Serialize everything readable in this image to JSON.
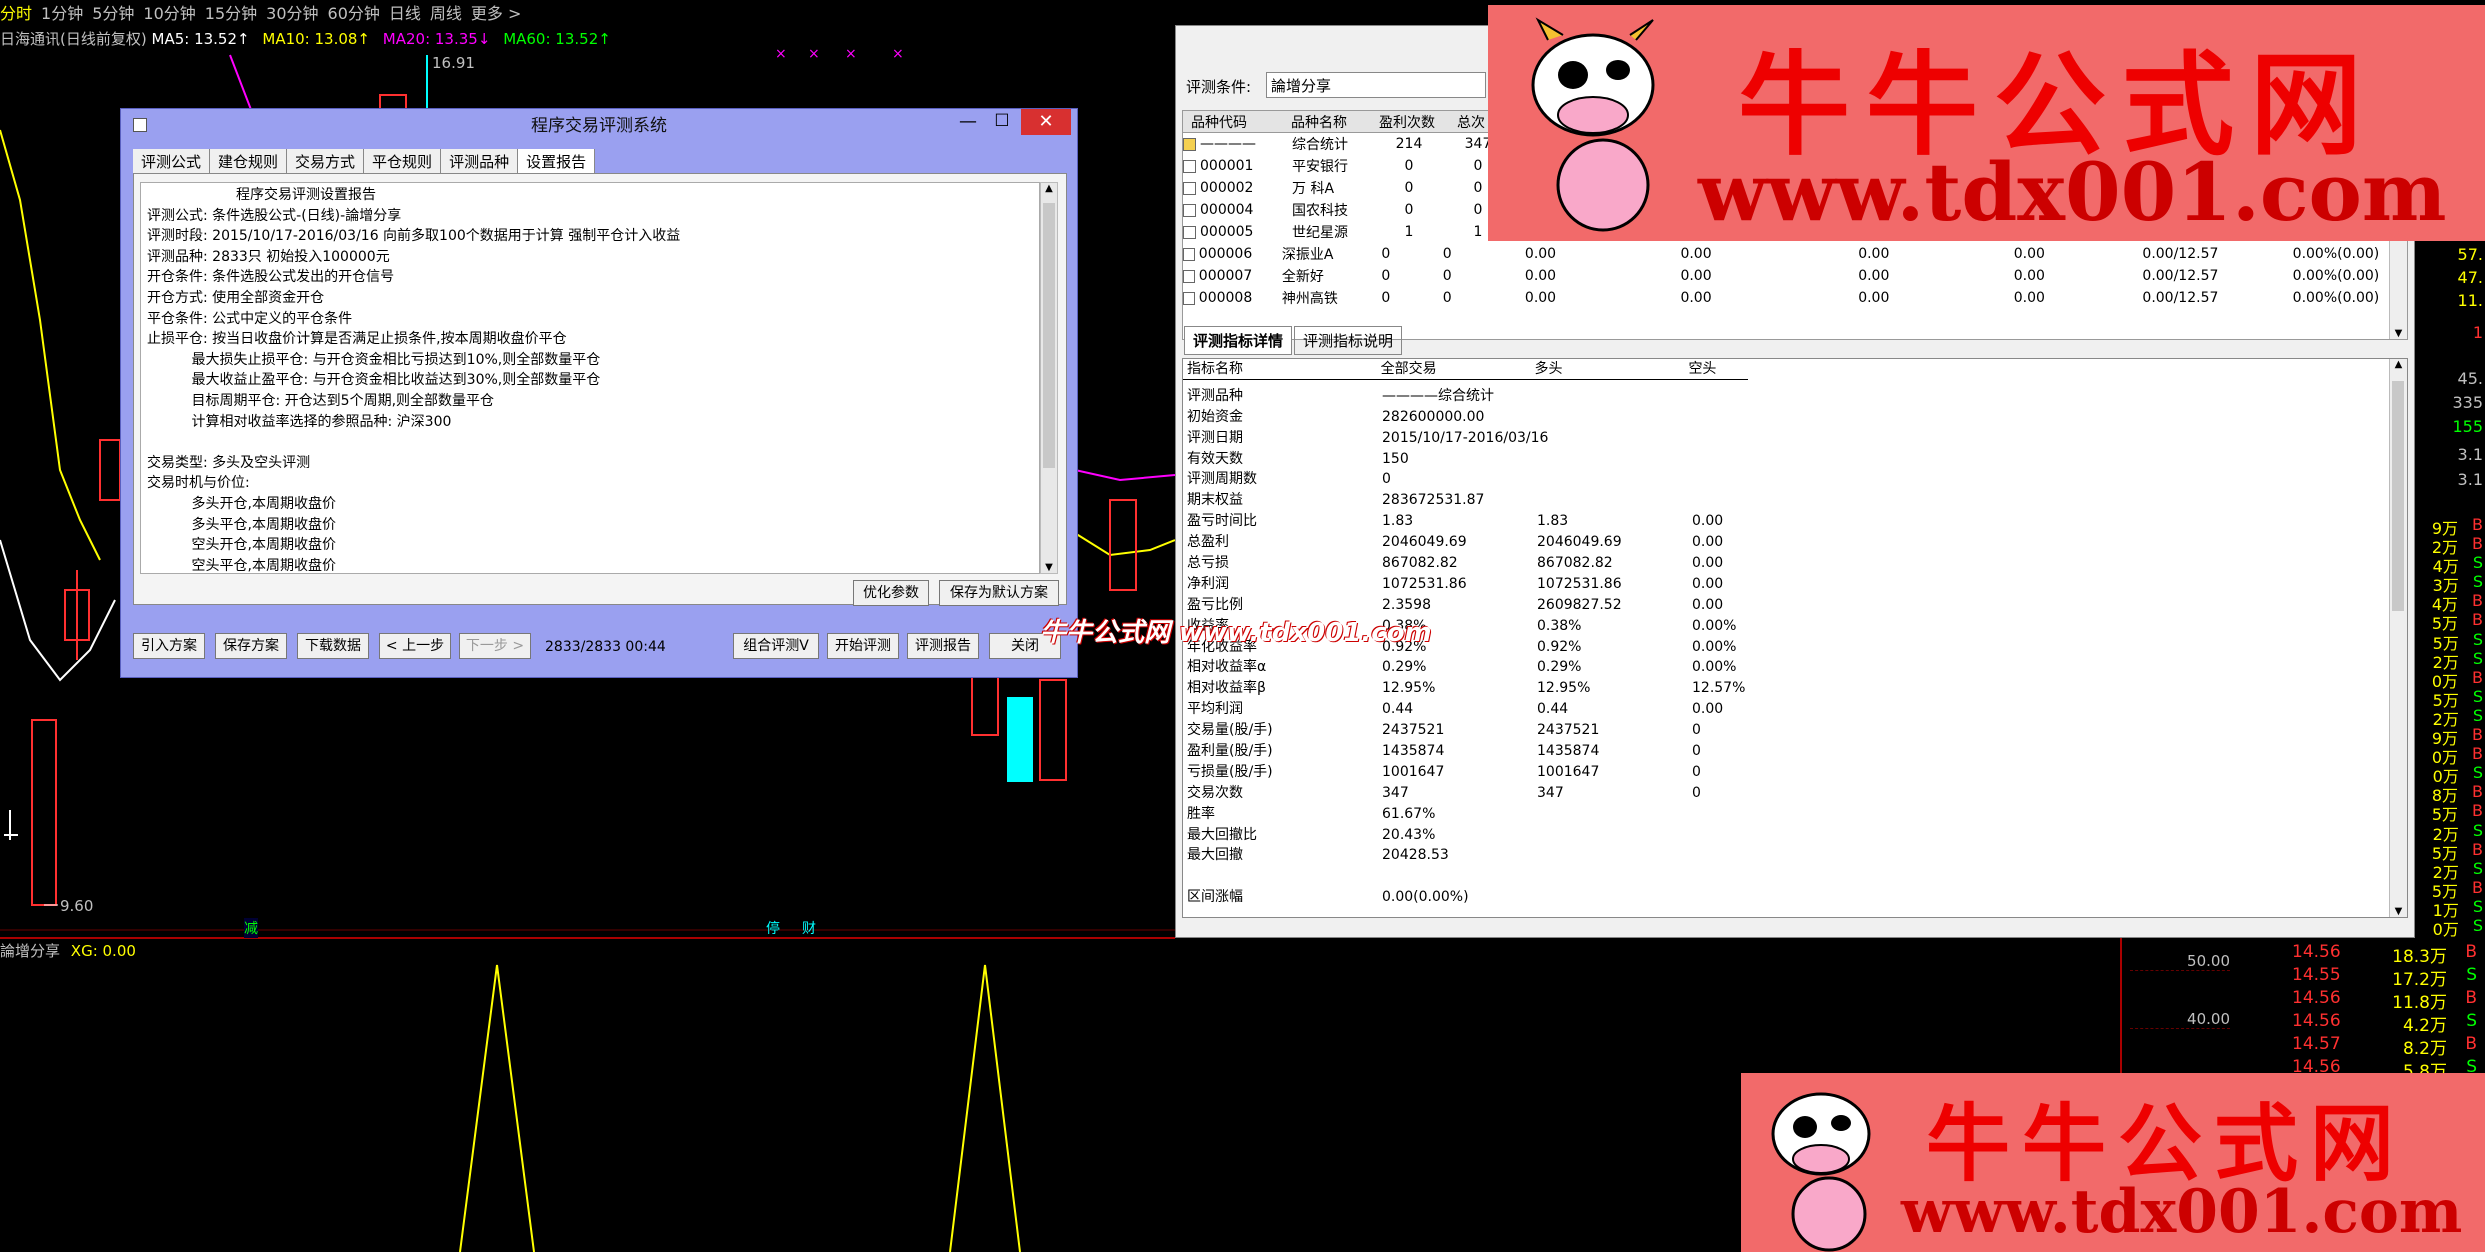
{
  "topbar": {
    "items": [
      "分时",
      "1分钟",
      "5分钟",
      "10分钟",
      "15分钟",
      "30分钟",
      "60分钟",
      "日线",
      "周线",
      "更多 >"
    ]
  },
  "chart": {
    "title": "日海通讯(日线前复权)",
    "ma5": "MA5: 13.52↑",
    "ma10": "MA10: 13.08↑",
    "ma20": "MA20: 13.35↓",
    "ma60": "MA60: 13.52↑",
    "high_label": "16.91",
    "low_label": "9.60",
    "marker_jian": "减",
    "marker_ting": "停",
    "marker_cai": "财",
    "sub_title": "論增分享",
    "sub_xg": "XG: 0.00",
    "sub_axis": [
      "50.00",
      "40.00"
    ],
    "colors": {
      "ma5": "#ffffff",
      "ma10": "#ffff00",
      "ma20": "#ff00ff",
      "ma60": "#00ff00",
      "up": "#ff3030",
      "down": "#00ffff"
    }
  },
  "dialog": {
    "title": "程序交易评测系统",
    "tabs": [
      "评测公式",
      "建仓规则",
      "交易方式",
      "平仓规则",
      "评测品种",
      "设置报告"
    ],
    "report_lines": [
      "                    程序交易评测设置报告",
      "评测公式: 条件选股公式-(日线)-論增分享",
      "评测时段: 2015/10/17-2016/03/16 向前多取100个数据用于计算 强制平仓计入收益",
      "评测品种: 2833只 初始投入100000元",
      "开仓条件: 条件选股公式发出的开仓信号",
      "开仓方式: 使用全部资金开仓",
      "平仓条件: 公式中定义的平仓条件",
      "止损平仓: 按当日收盘价计算是否满足止损条件,按本周期收盘价平仓",
      "          最大损失止损平仓: 与开仓资金相比亏损达到10%,则全部数量平仓",
      "          最大收益止盈平仓: 与开仓资金相比收益达到30%,则全部数量平仓",
      "          目标周期平仓: 开仓达到5个周期,则全部数量平仓",
      "          计算相对收益率选择的参照品种: 沪深300",
      "",
      "交易类型: 多头及空头评测",
      "交易时机与价位:",
      "          多头开仓,本周期收盘价",
      "          多头平仓,本周期收盘价",
      "          空头开仓,本周期收盘价",
      "          空头平仓,本周期收盘价"
    ],
    "btn_optimize": "优化参数",
    "btn_save_default": "保存为默认方案",
    "btn_import": "引入方案",
    "btn_save": "保存方案",
    "btn_download": "下载数据",
    "btn_prev": "< 上一步",
    "btn_next": "下一步 >",
    "progress": "2833/2833 00:44",
    "btn_combo": "组合评测V",
    "btn_start": "开始评测",
    "btn_report": "评测报告",
    "btn_close": "关闭"
  },
  "right": {
    "cond_label": "评测条件:",
    "cond_value": "論增分享",
    "headers": [
      "品种代码",
      "品种名称",
      "盈利次数",
      "总次"
    ],
    "rows": [
      {
        "code": "————",
        "name": "综合统计",
        "win": "214",
        "total": "347",
        "cols": []
      },
      {
        "code": "000001",
        "name": "平安银行",
        "win": "0",
        "total": "0",
        "cols": []
      },
      {
        "code": "000002",
        "name": "万  科A",
        "win": "0",
        "total": "0",
        "cols": []
      },
      {
        "code": "000004",
        "name": "国农科技",
        "win": "0",
        "total": "0",
        "cols": []
      },
      {
        "code": "000005",
        "name": "世纪星源",
        "win": "1",
        "total": "1",
        "cols": []
      },
      {
        "code": "000006",
        "name": "深振业A",
        "win": "0",
        "total": "0",
        "cols": [
          "0.00",
          "0.00",
          "0.00",
          "0.00",
          "0.00/12.57",
          "0.00%(0.00)"
        ]
      },
      {
        "code": "000007",
        "name": "全新好",
        "win": "0",
        "total": "0",
        "cols": [
          "0.00",
          "0.00",
          "0.00",
          "0.00",
          "0.00/12.57",
          "0.00%(0.00)"
        ]
      },
      {
        "code": "000008",
        "name": "神州高铁",
        "win": "0",
        "total": "0",
        "cols": [
          "0.00",
          "0.00",
          "0.00",
          "0.00",
          "0.00/12.57",
          "0.00%(0.00)"
        ]
      }
    ],
    "tab_detail": "评测指标详情",
    "tab_explain": "评测指标说明",
    "metric_headers": [
      "指标名称",
      "全部交易",
      "多头",
      "空头"
    ],
    "metrics": [
      [
        "评测品种",
        "————综合统计",
        "",
        ""
      ],
      [
        "初始资金",
        "282600000.00",
        "",
        ""
      ],
      [
        "评测日期",
        "2015/10/17-2016/03/16",
        "",
        ""
      ],
      [
        "有效天数",
        "150",
        "",
        ""
      ],
      [
        "评测周期数",
        "0",
        "",
        ""
      ],
      [
        "期末权益",
        "283672531.87",
        "",
        ""
      ],
      [
        "盈亏时间比",
        "1.83",
        "1.83",
        "0.00"
      ],
      [
        "总盈利",
        "2046049.69",
        "2046049.69",
        "0.00"
      ],
      [
        "总亏损",
        "867082.82",
        "867082.82",
        "0.00"
      ],
      [
        "净利润",
        "1072531.86",
        "1072531.86",
        "0.00"
      ],
      [
        "盈亏比例",
        "2.3598",
        "2609827.52",
        "0.00"
      ],
      [
        "收益率",
        "0.38%",
        "0.38%",
        "0.00%"
      ],
      [
        "年化收益率",
        "0.92%",
        "0.92%",
        "0.00%"
      ],
      [
        "相对收益率α",
        "0.29%",
        "0.29%",
        "0.00%"
      ],
      [
        "相对收益率β",
        "12.95%",
        "12.95%",
        "12.57%"
      ],
      [
        "平均利润",
        "0.44",
        "0.44",
        "0.00"
      ],
      [
        "交易量(股/手)",
        "2437521",
        "2437521",
        "0"
      ],
      [
        "盈利量(股/手)",
        "1435874",
        "1435874",
        "0"
      ],
      [
        "亏损量(股/手)",
        "1001647",
        "1001647",
        "0"
      ],
      [
        "交易次数",
        "347",
        "347",
        "0"
      ],
      [
        "胜率",
        "61.67%",
        "",
        ""
      ],
      [
        "最大回撤比",
        "20.43%",
        "",
        ""
      ],
      [
        "最大回撤",
        "20428.53",
        "",
        ""
      ],
      [
        "",
        "",
        "",
        ""
      ],
      [
        "区间涨幅",
        "0.00(0.00%)",
        "",
        ""
      ]
    ]
  },
  "watermark": "牛牛公式网 www.tdx001.com",
  "ads": {
    "name": "牛牛公式网",
    "url": "www.tdx001.com"
  },
  "right_edge": {
    "vals": [
      "57.",
      "47.",
      "11.",
      "1",
      "45.",
      "335",
      "155",
      "3.1",
      "3.1"
    ],
    "vols": [
      "9万",
      "2万",
      "4万",
      "3万",
      "4万",
      "5万",
      "5万",
      "2万",
      "0万",
      "5万",
      "2万",
      "9万",
      "0万",
      "0万",
      "8万",
      "5万",
      "2万",
      "5万",
      "2万",
      "5万",
      "1万",
      "0万"
    ],
    "bs": [
      "B",
      "B",
      "S",
      "S",
      "B",
      "B",
      "S",
      "S",
      "B",
      "S",
      "S",
      "B",
      "B",
      "S",
      "B",
      "B",
      "S",
      "B",
      "S",
      "B",
      "S",
      "S"
    ]
  },
  "ticks": [
    {
      "price": "14.56",
      "vol": "18.3万",
      "bs": "B"
    },
    {
      "price": "14.55",
      "vol": "17.2万",
      "bs": "S"
    },
    {
      "price": "14.56",
      "vol": "11.8万",
      "bs": "B"
    },
    {
      "price": "14.56",
      "vol": "4.2万",
      "bs": "S"
    },
    {
      "price": "14.57",
      "vol": "8.2万",
      "bs": "B"
    },
    {
      "price": "14.56",
      "vol": "5.8万",
      "bs": "S"
    }
  ]
}
